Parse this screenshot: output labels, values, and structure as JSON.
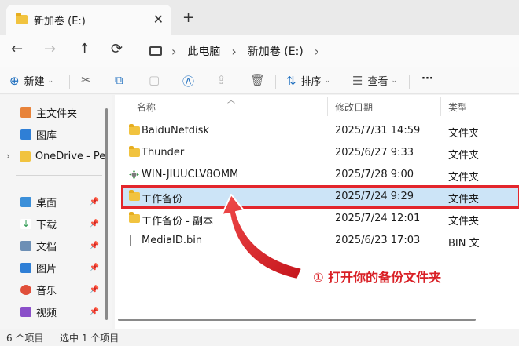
{
  "tab": {
    "title": "新加卷 (E:)",
    "close": "✕",
    "add": "+"
  },
  "nav": {
    "back": "←",
    "forward": "→",
    "up": "↑",
    "refresh": "⟳",
    "sep": "›",
    "breadcrumb": [
      "此电脑",
      "新加卷 (E:)"
    ]
  },
  "toolbar": {
    "new_label": "新建",
    "sort_label": "排序",
    "view_label": "查看",
    "more": "···"
  },
  "sidebar": {
    "items": [
      {
        "label": "主文件夹"
      },
      {
        "label": "图库"
      },
      {
        "label": "OneDrive - Pe"
      },
      {
        "label": "桌面"
      },
      {
        "label": "下载"
      },
      {
        "label": "文档"
      },
      {
        "label": "图片"
      },
      {
        "label": "音乐"
      },
      {
        "label": "视频"
      }
    ],
    "expand": "›",
    "pin": "📌"
  },
  "columns": {
    "name": "名称",
    "date": "修改日期",
    "type": "类型"
  },
  "files": [
    {
      "name": "BaiduNetdisk",
      "date": "2025/7/31 14:59",
      "type": "文件夹"
    },
    {
      "name": "Thunder",
      "date": "2025/6/27 9:33",
      "type": "文件夹"
    },
    {
      "name": "WIN-JIUUCLV8OMM",
      "date": "2025/7/28 9:00",
      "type": "文件夹"
    },
    {
      "name": "工作备份",
      "date": "2025/7/24 9:29",
      "type": "文件夹"
    },
    {
      "name": "工作备份 - 副本",
      "date": "2025/7/24 12:01",
      "type": "文件夹"
    },
    {
      "name": "MediaID.bin",
      "date": "2025/6/23 17:03",
      "type": "BIN 文件"
    }
  ],
  "annotation": "① 打开你的备份文件夹",
  "status": {
    "count": "6 个项目",
    "selected": "选中 1 个项目"
  },
  "colors": {
    "accent": "#1f6fbf",
    "highlight": "#e3262c",
    "selected_bg": "#cce4f7"
  }
}
